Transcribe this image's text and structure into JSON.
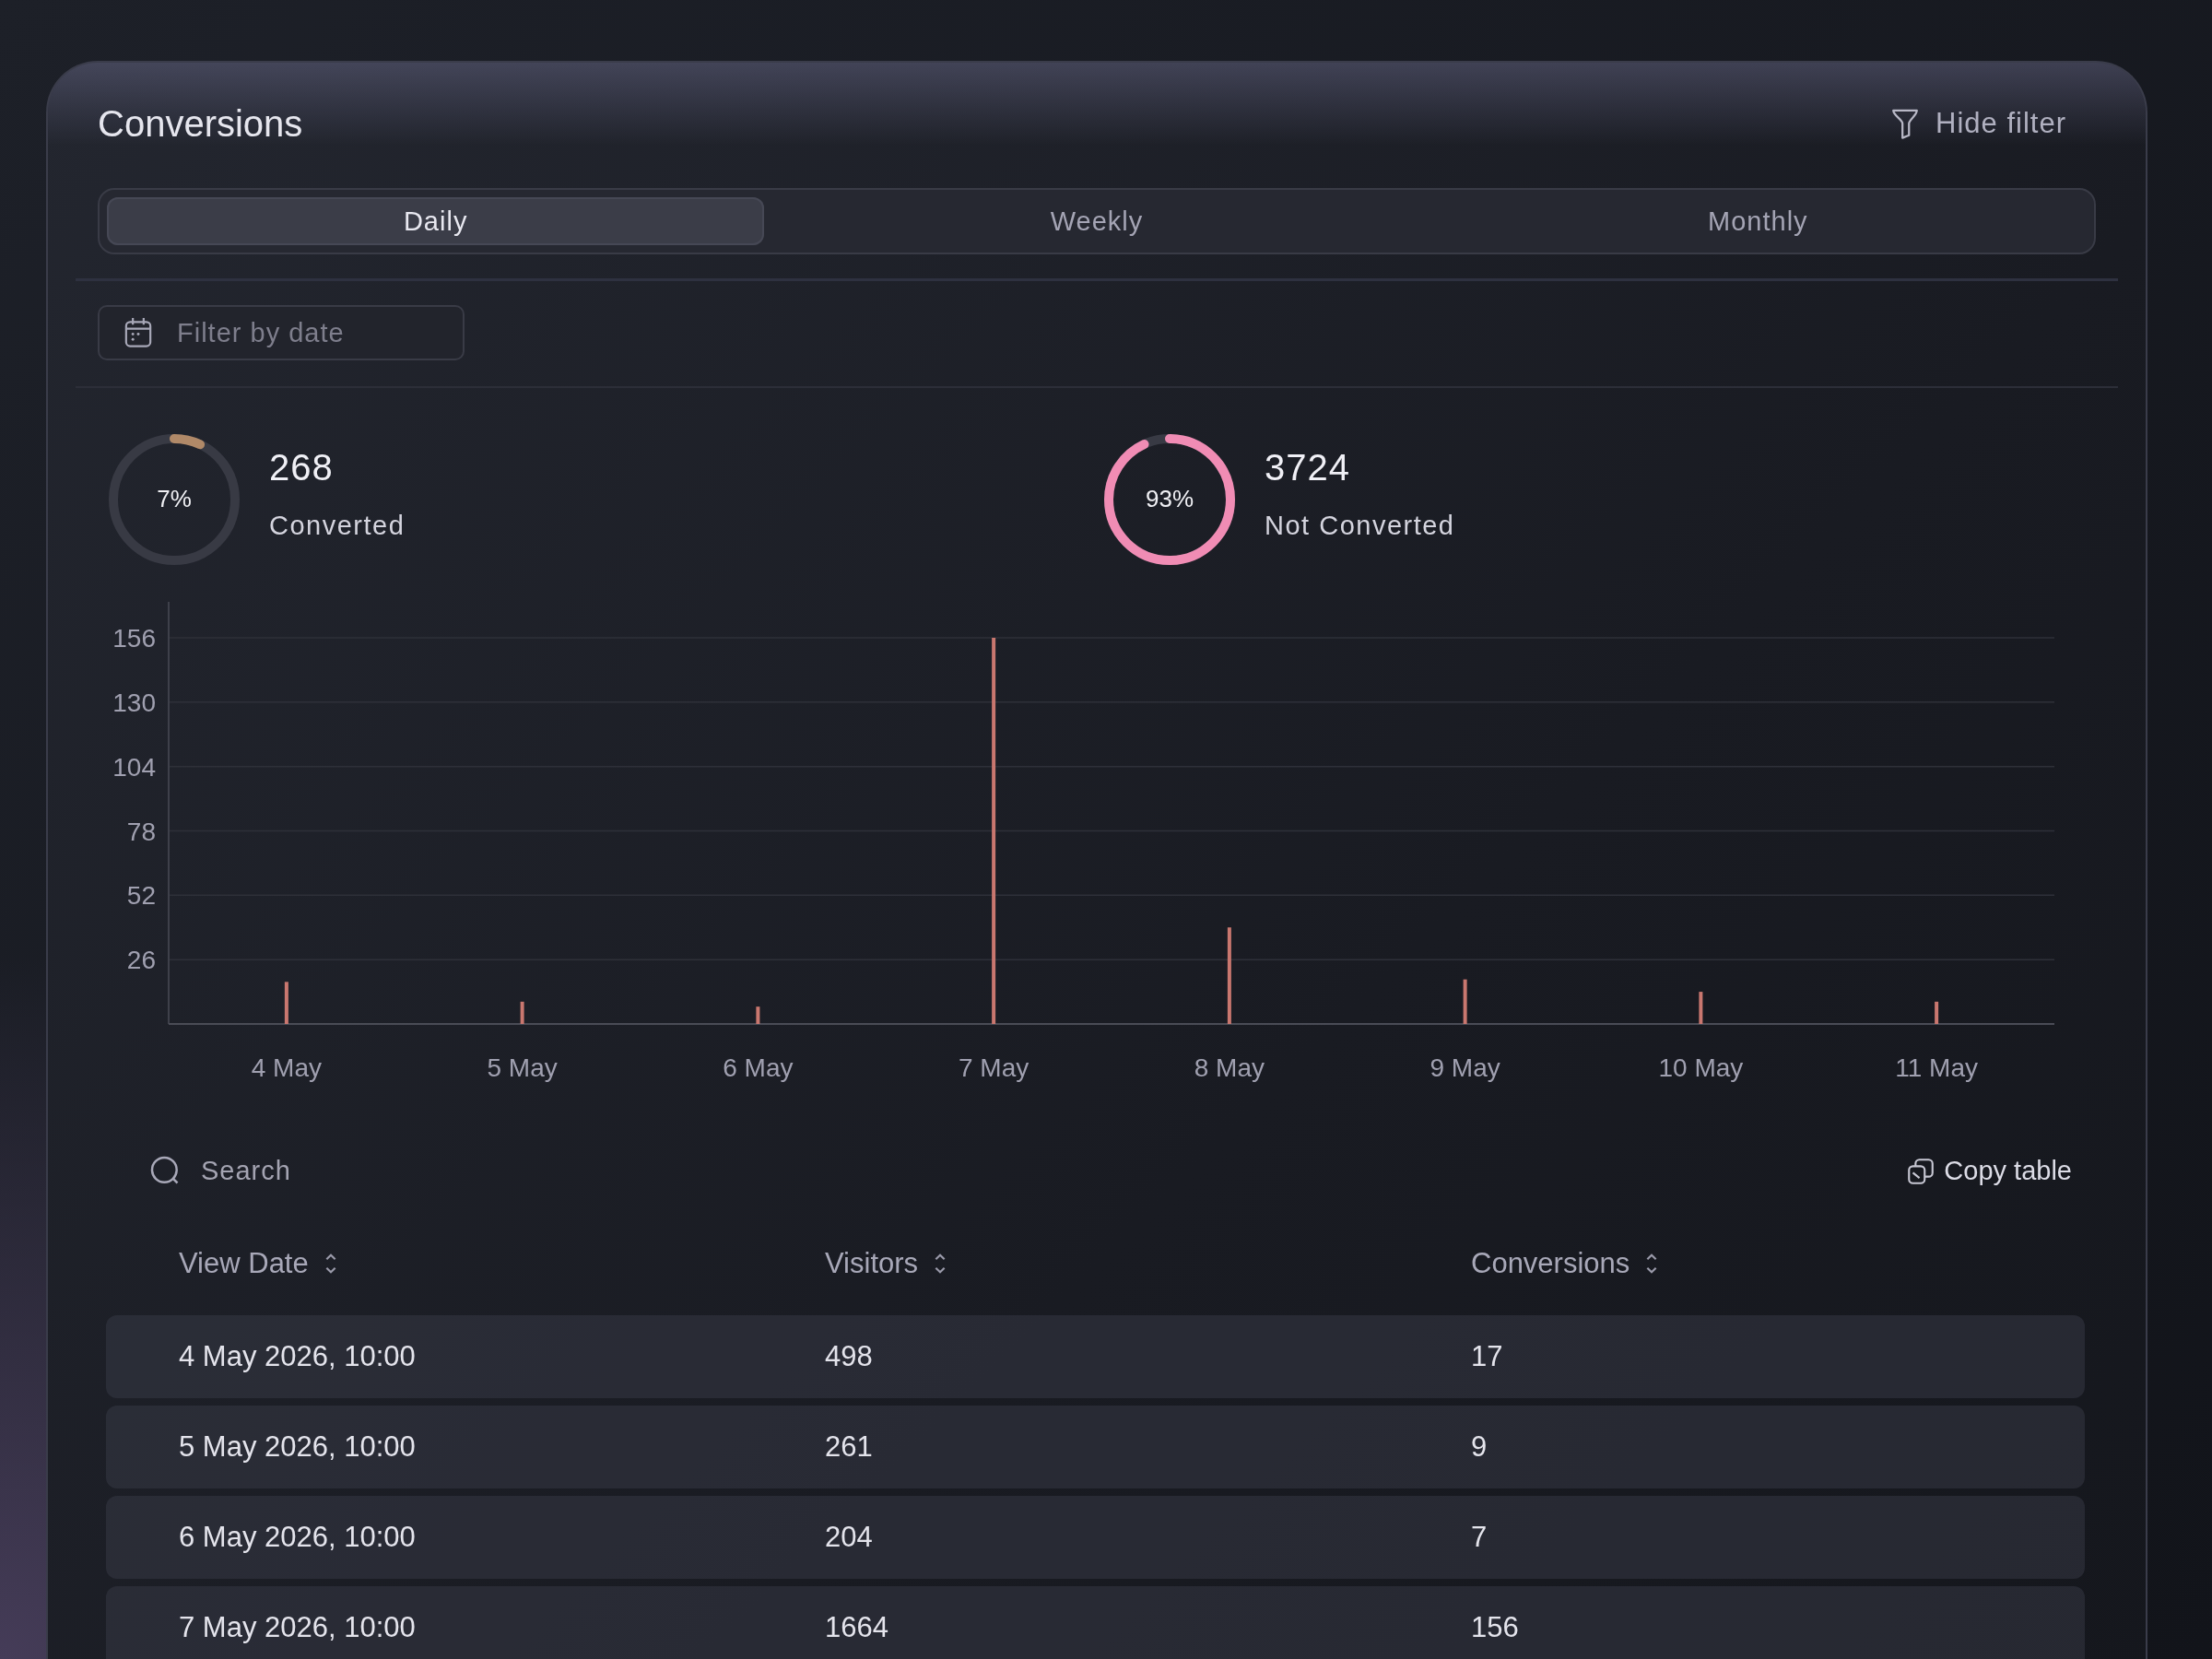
{
  "header": {
    "title": "Conversions",
    "filter_button": "Hide filter"
  },
  "tabs": [
    {
      "label": "Daily",
      "selected": true
    },
    {
      "label": "Weekly",
      "selected": false
    },
    {
      "label": "Monthly",
      "selected": false
    }
  ],
  "date_filter": {
    "placeholder": "Filter by date"
  },
  "stats": [
    {
      "percent": "7%",
      "level": 0.07,
      "color": "#b08968",
      "value": "268",
      "label": "Converted"
    },
    {
      "percent": "93%",
      "level": 0.93,
      "color": "#f08cb4",
      "value": "3724",
      "label": "Not Converted"
    }
  ],
  "chart": {
    "chart_data": {
      "type": "bar",
      "categories": [
        "4 May",
        "5 May",
        "6 May",
        "7 May",
        "8 May",
        "9 May",
        "10 May",
        "11 May"
      ],
      "series": [
        {
          "color": "#c9776f",
          "values": [
            17,
            9,
            7,
            156,
            39,
            18,
            13,
            9
          ]
        }
      ],
      "grid": true,
      "ylim": [
        0,
        156
      ],
      "yticks": [
        26,
        52,
        78,
        104,
        130,
        156
      ]
    }
  },
  "table": {
    "search": {
      "placeholder": "Search"
    },
    "copy_button": "Copy table",
    "columns": [
      {
        "label": "View Date",
        "sortable": true
      },
      {
        "label": "Visitors",
        "sortable": true
      },
      {
        "label": "Conversions",
        "sortable": true
      }
    ],
    "rows": [
      {
        "cells": [
          "4 May 2026, 10:00",
          "498",
          "17"
        ]
      },
      {
        "cells": [
          "5 May 2026, 10:00",
          "261",
          "9"
        ]
      },
      {
        "cells": [
          "6 May 2026, 10:00",
          "204",
          "7"
        ]
      },
      {
        "cells": [
          "7 May 2026, 10:00",
          "1664",
          "156"
        ]
      }
    ]
  }
}
